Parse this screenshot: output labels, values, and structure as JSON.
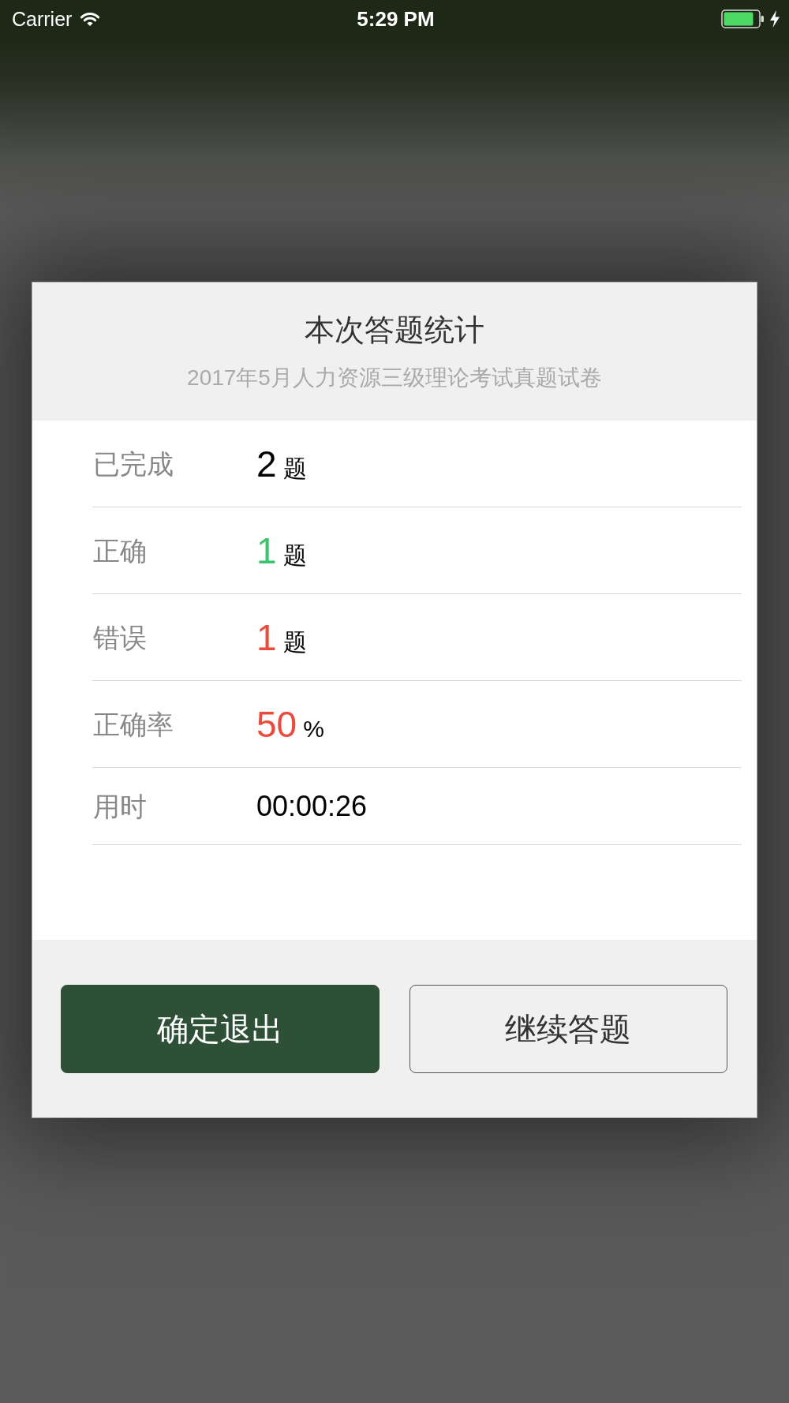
{
  "status_bar": {
    "carrier": "Carrier",
    "time": "5:29 PM",
    "charging": true
  },
  "dialog": {
    "title": "本次答题统计",
    "subtitle": "2017年5月人力资源三级理论考试真题试卷",
    "stats": [
      {
        "kind": "count",
        "label": "已完成",
        "value": "2",
        "unit": "题",
        "color": "#000000"
      },
      {
        "kind": "count",
        "label": "正确",
        "value": "1",
        "unit": "题",
        "color": "#3bc46c"
      },
      {
        "kind": "count",
        "label": "错误",
        "value": "1",
        "unit": "题",
        "color": "#e84c3d"
      },
      {
        "kind": "count",
        "label": "正确率",
        "value": "50",
        "unit": "%",
        "color": "#e84c3d"
      },
      {
        "kind": "duration",
        "label": "用时",
        "value": "00:00:26",
        "color": "#000000"
      }
    ],
    "buttons": [
      {
        "kind": "primary",
        "label": "确定退出"
      },
      {
        "kind": "secondary",
        "label": "继续答题"
      }
    ]
  }
}
